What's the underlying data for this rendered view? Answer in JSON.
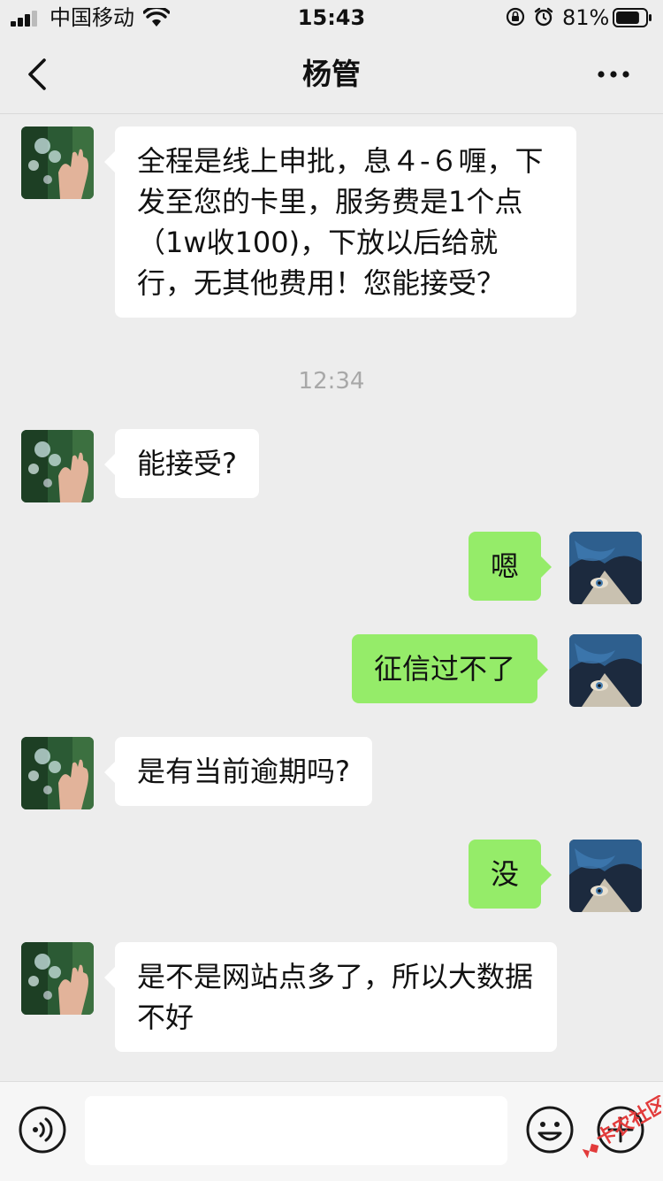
{
  "status_bar": {
    "carrier": "中国移动",
    "time": "15:43",
    "battery_percent": "81%",
    "battery_level": 0.81
  },
  "nav": {
    "title": "杨管"
  },
  "messages": [
    {
      "side": "in",
      "text": "全程是线上申批，息４-６喱，下发至您的卡里，服务费是1个点（1w收100)，下放以后给就行，无其他费用！您能接受？"
    },
    {
      "side": "in",
      "text": "能接受?"
    },
    {
      "side": "out",
      "text": "嗯"
    },
    {
      "side": "out",
      "text": "征信过不了"
    },
    {
      "side": "in",
      "text": "是有当前逾期吗?"
    },
    {
      "side": "out",
      "text": "没"
    },
    {
      "side": "in",
      "text": "是不是网站点多了，所以大数据不好"
    }
  ],
  "timestamp": "12:34",
  "input_bar": {
    "value": ""
  },
  "watermark": {
    "text": "卡农社区"
  },
  "colors": {
    "background": "#ededed",
    "incoming_bubble": "#ffffff",
    "outgoing_bubble": "#95ec69",
    "timestamp": "#a8a8a8"
  },
  "icons": {
    "back": "chevron-left-icon",
    "more": "more-dots-icon",
    "voice": "voice-icon",
    "emoji": "emoji-icon",
    "plus": "plus-icon"
  }
}
